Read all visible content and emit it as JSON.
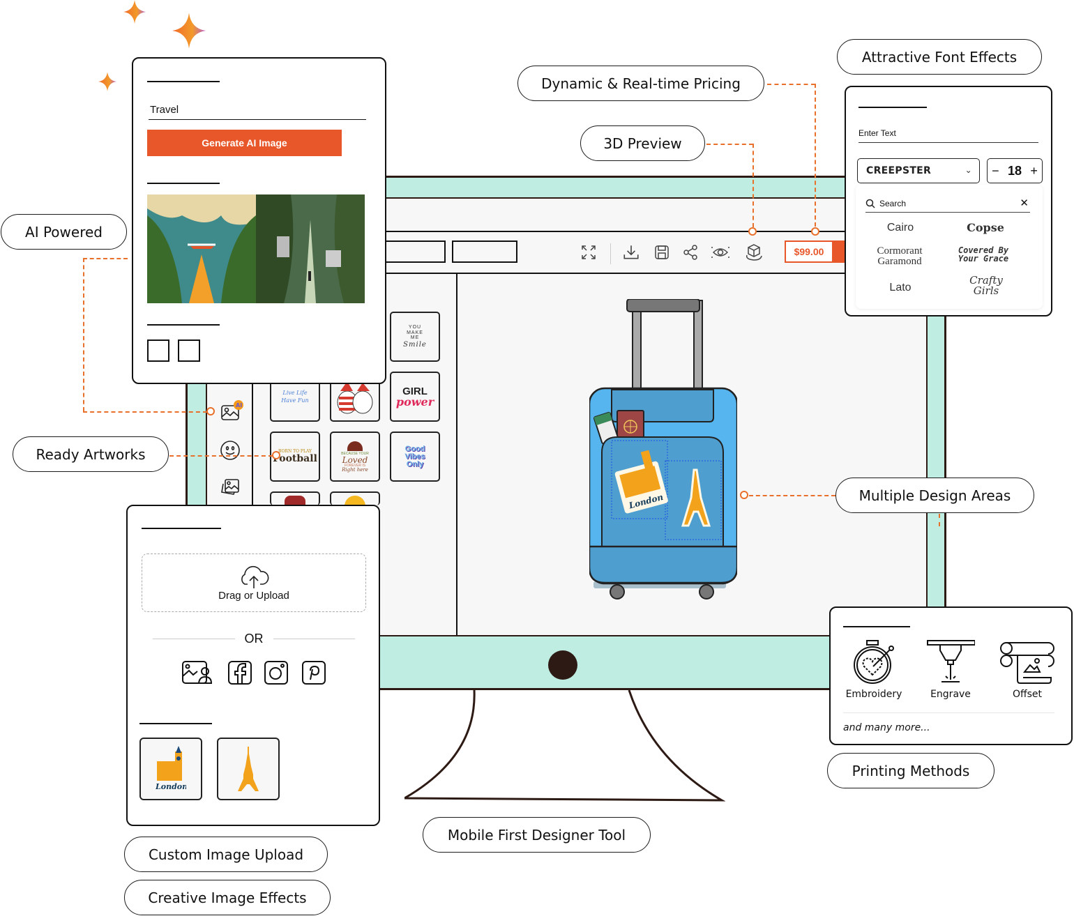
{
  "colors": {
    "accent": "#e8572a",
    "connector": "#e8702a",
    "monitor_bezel": "#bfede1",
    "monitor_outline": "#2d1a14",
    "screen_bg": "#f7f7f7"
  },
  "feature_labels": {
    "ai_powered": "AI Powered",
    "ready_artworks": "Ready Artworks",
    "dynamic_pricing": "Dynamic & Real-time Pricing",
    "preview_3d": "3D Preview",
    "font_effects": "Attractive Font Effects",
    "design_areas": "Multiple Design Areas",
    "printing_methods": "Printing Methods",
    "mobile_first": "Mobile First Designer Tool",
    "custom_upload": "Custom Image Upload",
    "image_effects": "Creative Image Effects"
  },
  "ai_card": {
    "prompt_value": "Travel",
    "generate_button": "Generate AI Image",
    "generated_images": [
      "travel-road-airplane-image",
      "travel-jungle-city-image"
    ]
  },
  "toolbar": {
    "icons": [
      "expand-icon",
      "download-icon",
      "save-icon",
      "share-icon",
      "preview-eye-icon",
      "3d-preview-icon"
    ],
    "price": "$99.00"
  },
  "sidebar": {
    "items": [
      {
        "icon": "ai-image-icon",
        "badge": "AI"
      },
      {
        "icon": "smiley-icon"
      },
      {
        "icon": "gallery-icon"
      }
    ]
  },
  "artworks": [
    {
      "name": "you-make-me-smile",
      "text": "YOU MAKE ME Smile"
    },
    {
      "name": "live-life-have-fun",
      "text": "Live Life Have Fun"
    },
    {
      "name": "christmas-cats",
      "text": ""
    },
    {
      "name": "girl-power",
      "text": "GIRL power"
    },
    {
      "name": "born-to-play-football",
      "text": "BORN TO PLAY Football"
    },
    {
      "name": "coffee-loved",
      "text": "Loved"
    },
    {
      "name": "good-vibes-only",
      "text": "Good Vibes Only"
    },
    {
      "name": "red-hat-artwork",
      "text": ""
    },
    {
      "name": "yellow-character-artwork",
      "text": ""
    }
  ],
  "canvas": {
    "product": "suitcase",
    "stickers": [
      "London",
      "Eiffel Tower"
    ]
  },
  "font_card": {
    "text_placeholder": "Enter Text",
    "selected_font": "CREEPSTER",
    "font_size": "18",
    "search_placeholder": "Search",
    "fonts": [
      "Cairo",
      "Copse",
      "Cormorant Garamond",
      "Covered By Your Grace",
      "Lato",
      "Crafty Girls"
    ]
  },
  "upload_card": {
    "drop_label": "Drag or Upload",
    "or_label": "OR",
    "sources": [
      "gallery-icon",
      "facebook-icon",
      "instagram-icon",
      "pinterest-icon"
    ],
    "uploaded": [
      {
        "name": "london-sticker",
        "text": "London"
      },
      {
        "name": "eiffel-tower-sticker",
        "text": ""
      }
    ]
  },
  "printing_card": {
    "methods": [
      "Embroidery",
      "Engrave",
      "Offset"
    ],
    "more": "and many more..."
  }
}
